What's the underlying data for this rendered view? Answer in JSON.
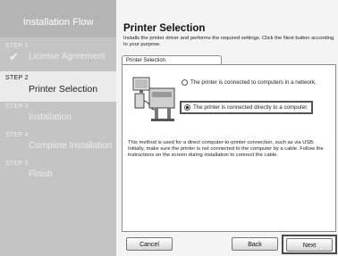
{
  "sidebar": {
    "header": "Installation Flow",
    "steps": [
      {
        "num": "STEP 1",
        "label": "License Agreement",
        "state": "done"
      },
      {
        "num": "STEP 2",
        "label": "Printer Selection",
        "state": "active"
      },
      {
        "num": "STEP 3",
        "label": "Installation",
        "state": "pending"
      },
      {
        "num": "STEP 4",
        "label": "Complete Installation",
        "state": "pending"
      },
      {
        "num": "STEP 5",
        "label": "Finish",
        "state": "pending"
      }
    ]
  },
  "main": {
    "title": "Printer Selection",
    "subtitle": "Installs the printer driver and performs the required settings. Click the Next button according to your purpose.",
    "tab_label": "Printer Selection",
    "options": [
      {
        "label": "The printer is connected to computers in a network.",
        "selected": false
      },
      {
        "label": "The printer is connected directly to a computer.",
        "selected": true
      }
    ],
    "description": "This method is used for a direct computer-to-printer connection, such as via USB. Initially, make sure the printer is not connected to the computer by a cable. Follow the instructions on the screen during installation to connect the cable."
  },
  "buttons": {
    "cancel": "Cancel",
    "back": "Back",
    "next": "Next"
  },
  "colors": {
    "sidebar_bg": "#c4c4c4",
    "active_step_bg": "#ebebeb",
    "highlight_border": "#4a4a4a"
  }
}
